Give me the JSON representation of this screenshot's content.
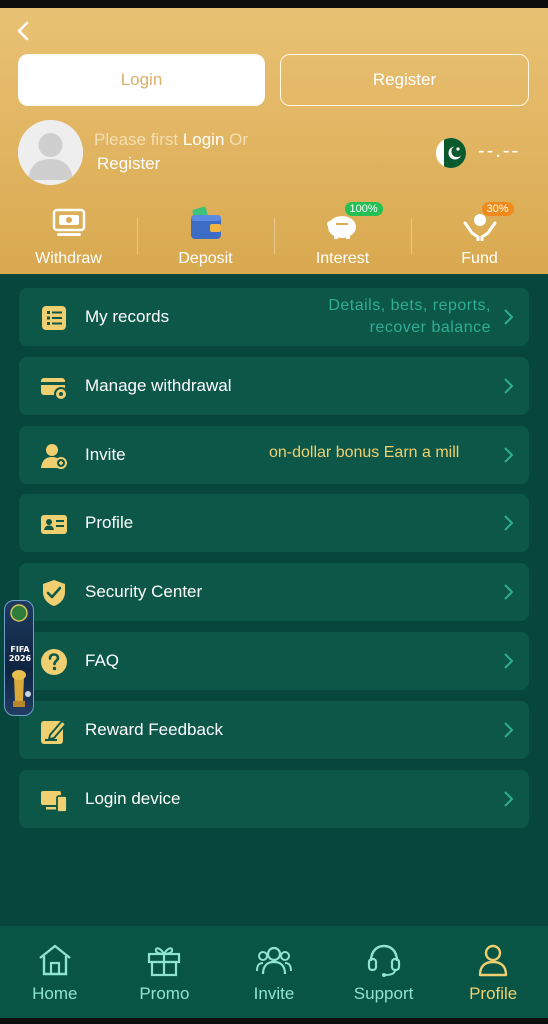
{
  "header": {
    "login_button": "Login",
    "register_button": "Register",
    "prompt_muted_1": "Please first ",
    "prompt_login": "Login",
    "prompt_muted_2": " Or",
    "prompt_register": "Register",
    "balance": "--.--",
    "flag_country": "Pakistan"
  },
  "quick_actions": [
    {
      "label": "Withdraw",
      "icon": "withdraw-icon"
    },
    {
      "label": "Deposit",
      "icon": "wallet-icon"
    },
    {
      "label": "Interest",
      "icon": "piggy-bank-icon",
      "badge": "100%"
    },
    {
      "label": "Fund",
      "icon": "fund-hands-icon",
      "badge": "30%"
    }
  ],
  "menu": [
    {
      "label": "My records",
      "icon": "records-list-icon",
      "sub_line1": "Details,  bets,  reports,",
      "sub_line2": "recover balance"
    },
    {
      "label": "Manage withdrawal",
      "icon": "card-settings-icon"
    },
    {
      "label": "Invite",
      "icon": "invite-user-icon",
      "marquee": "on-dollar bonus Earn a mill"
    },
    {
      "label": "Profile",
      "icon": "profile-card-icon"
    },
    {
      "label": "Security Center",
      "icon": "shield-check-icon"
    },
    {
      "label": "FAQ",
      "icon": "question-icon"
    },
    {
      "label": "Reward Feedback",
      "icon": "edit-note-icon"
    },
    {
      "label": "Login device",
      "icon": "devices-icon"
    }
  ],
  "float_banner": {
    "line1": "FIFA",
    "line2": "2026"
  },
  "bottom_nav": [
    {
      "label": "Home",
      "icon": "home-icon"
    },
    {
      "label": "Promo",
      "icon": "gift-icon"
    },
    {
      "label": "Invite",
      "icon": "users-icon"
    },
    {
      "label": "Support",
      "icon": "headset-icon"
    },
    {
      "label": "Profile",
      "icon": "person-icon",
      "active": true
    }
  ],
  "colors": {
    "header_gold": "#e2b664",
    "background": "#07463c",
    "card": "#0c5748",
    "accent_gold": "#f0cf70",
    "accent_teal": "#2fae93"
  }
}
